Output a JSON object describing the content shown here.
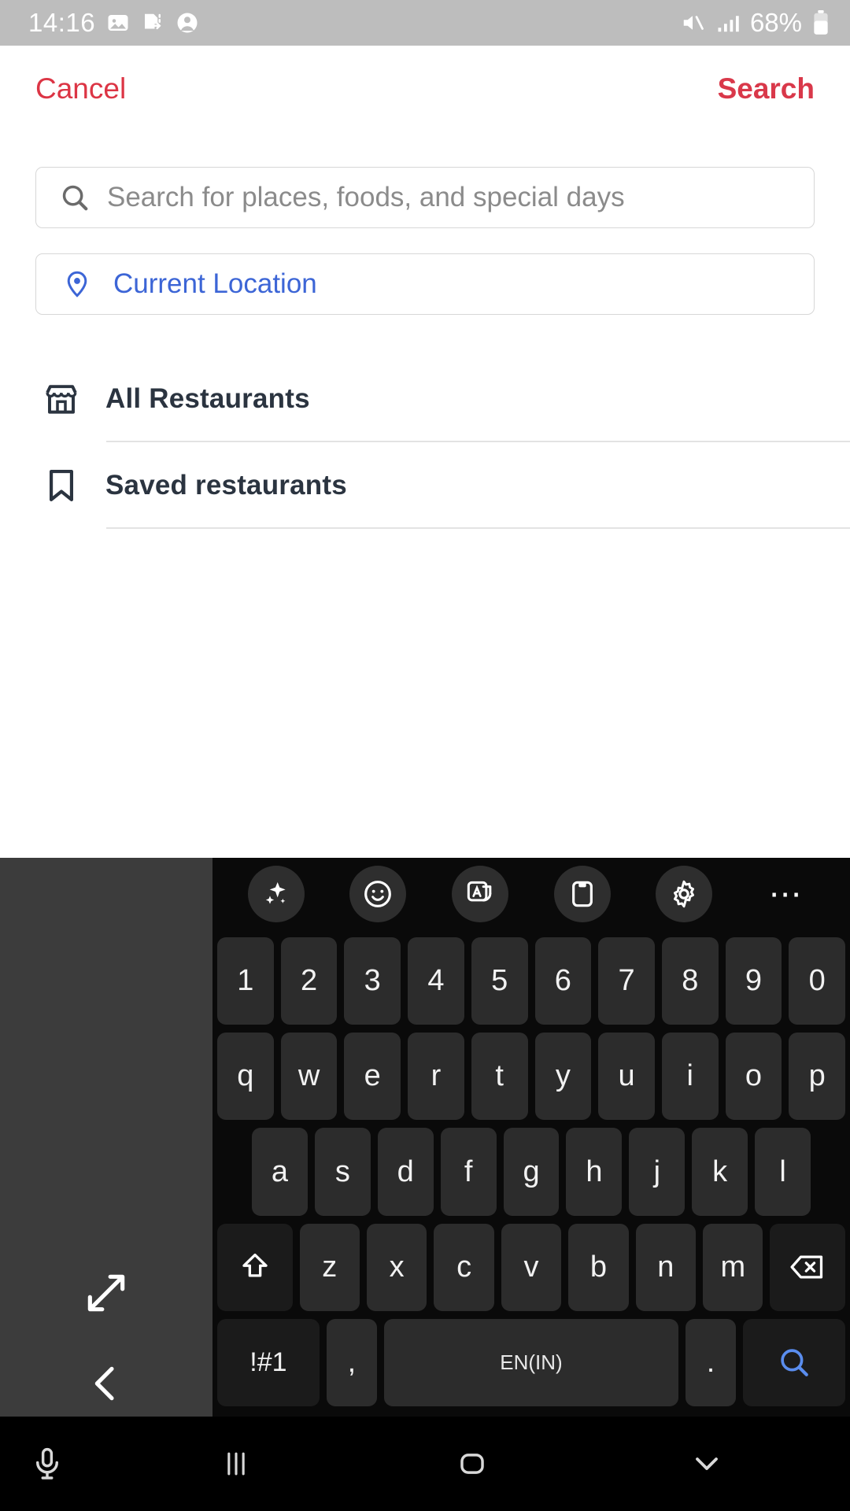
{
  "status_bar": {
    "time": "14:16",
    "battery": "68%",
    "icons_left": [
      "image-icon",
      "file-transfer-icon",
      "account-icon"
    ],
    "icons_right": [
      "mute-icon",
      "signal-icon",
      "battery-icon"
    ],
    "background": "#bdbdbd"
  },
  "top_bar": {
    "cancel_label": "Cancel",
    "search_label": "Search",
    "accent": "#dc3545"
  },
  "search": {
    "placeholder": "Search for places, foods, and special days",
    "value": "",
    "icon": "search-icon"
  },
  "current_location": {
    "label": "Current Location",
    "icon": "map-pin-icon",
    "color": "#3c65d6"
  },
  "list": {
    "items": [
      {
        "label": "All Restaurants",
        "icon": "storefront-icon"
      },
      {
        "label": "Saved restaurants",
        "icon": "bookmark-icon"
      }
    ]
  },
  "keyboard": {
    "toolbar": [
      {
        "name": "ai-sparkle-icon"
      },
      {
        "name": "emoji-icon"
      },
      {
        "name": "translate-icon"
      },
      {
        "name": "clipboard-icon"
      },
      {
        "name": "settings-gear-icon"
      },
      {
        "name": "more-options-icon"
      }
    ],
    "rows": {
      "numbers": [
        "1",
        "2",
        "3",
        "4",
        "5",
        "6",
        "7",
        "8",
        "9",
        "0"
      ],
      "top": [
        "q",
        "w",
        "e",
        "r",
        "t",
        "y",
        "u",
        "i",
        "o",
        "p"
      ],
      "home": [
        "a",
        "s",
        "d",
        "f",
        "g",
        "h",
        "j",
        "k",
        "l"
      ],
      "bottom": [
        "z",
        "x",
        "c",
        "v",
        "b",
        "n",
        "m"
      ]
    },
    "shift_key": "shift-icon",
    "backspace_key": "backspace-icon",
    "symbols_key": "!#1",
    "comma_key": ",",
    "spacebar_label": "EN(IN)",
    "period_key": ".",
    "go_key": "search-icon",
    "side_panel": {
      "expand": "expand-icon",
      "back": "chevron-left-icon"
    },
    "accent": "#5a8dee"
  },
  "nav_bar": {
    "items": [
      {
        "name": "microphone-icon"
      },
      {
        "name": "recents-icon"
      },
      {
        "name": "home-icon"
      },
      {
        "name": "hide-keyboard-icon"
      }
    ]
  }
}
